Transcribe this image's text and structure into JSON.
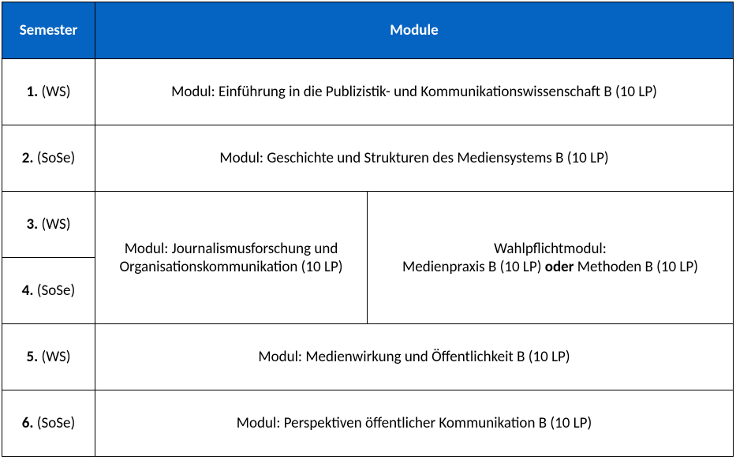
{
  "headers": {
    "semester": "Semester",
    "module": "Module"
  },
  "rows": [
    {
      "semester_num": "1.",
      "semester_term": " (WS)",
      "module": "Modul: Einführung in die Publizistik- und Kommunikationswissenschaft B (10 LP)"
    },
    {
      "semester_num": "2.",
      "semester_term": " (SoSe)",
      "module": "Modul: Geschichte und Strukturen des Mediensystems B (10 LP)"
    },
    {
      "semester_num": "3.",
      "semester_term": " (WS)",
      "module_left": "Modul: Journalismusforschung und Organisationskommunikation (10 LP)",
      "module_right_pre": "Wahlpflichtmodul:",
      "module_right_line2a": "Medienpraxis B (10 LP) ",
      "module_right_bold": "oder",
      "module_right_line2b": " Methoden B (10 LP)"
    },
    {
      "semester_num": "4.",
      "semester_term": " (SoSe)"
    },
    {
      "semester_num": "5.",
      "semester_term": " (WS)",
      "module": "Modul: Medienwirkung und Öffentlichkeit B (10 LP)"
    },
    {
      "semester_num": "6.",
      "semester_term": " (SoSe)",
      "module": "Modul: Perspektiven öffentlicher Kommunikation B (10 LP)"
    }
  ]
}
